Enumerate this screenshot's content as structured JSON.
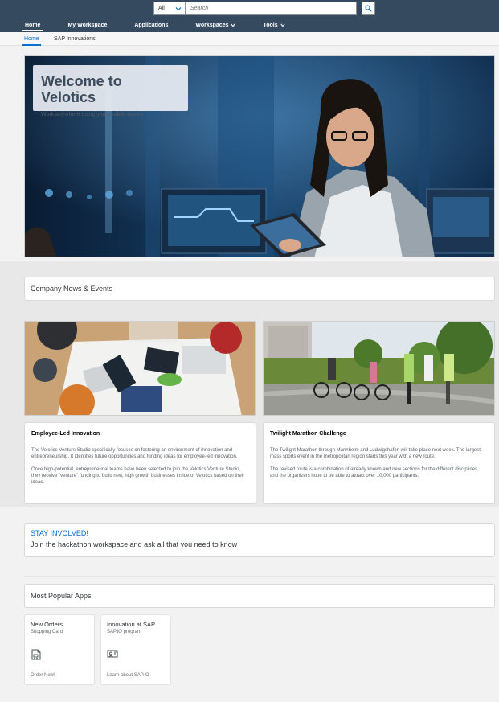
{
  "search": {
    "scope": "All",
    "placeholder": "Search",
    "icon": "search-icon"
  },
  "nav": {
    "home": "Home",
    "my_workspace": "My Workspace",
    "applications": "Applications",
    "workspaces": "Workspaces",
    "tools": "Tools"
  },
  "subnav": {
    "home": "Home",
    "sap_innovations": "SAP Innovations"
  },
  "hero": {
    "title": "Welcome to Velotics",
    "subtitle": "Work anywhere using your mobile device"
  },
  "news": {
    "title": "Company News & Events"
  },
  "articles": [
    {
      "title": "Employee-Led Innovation",
      "p1": "The Velotics Venture Studio specifically focuses on fostering an environment of innovation and entrepreneurship. It identifies future opportunities and funding ideas for employee-led innovation.",
      "p2": "Once high-potential, entrepreneurial teams have been selected to join the Velotics Venture Studio, they receive \"venture\" funding to build new, high growth businesses inside of Velotics based on their ideas."
    },
    {
      "title": "Twilight Marathon Challenge",
      "p1": "The Twilight Marathon through Mannheim and Ludwigshafen will take place next week. The largest mass sports event in the metropolitan region starts this year with a new route.",
      "p2": "The revised route is a combination of already known and new sections for the different disciplines, and the organizers hope to be able to attract over 10,000 participants."
    }
  ],
  "stay": {
    "title": "STAY INVOLVED!",
    "text": "Join the hackathon workspace and ask all that you need to know"
  },
  "apps": {
    "title": "Most Popular Apps",
    "tiles": [
      {
        "title": "New Orders",
        "subtitle": "Shopping Card",
        "footer": "Order Now!",
        "icon": "document-cart-icon"
      },
      {
        "title": "Innovation at SAP",
        "subtitle": "SAP.iO program",
        "footer": "Learn about SAP.iO",
        "icon": "presentation-person-icon"
      }
    ]
  },
  "colors": {
    "shell": "#354a5f",
    "accent": "#0a6ed1",
    "page": "#f2f2f2"
  }
}
